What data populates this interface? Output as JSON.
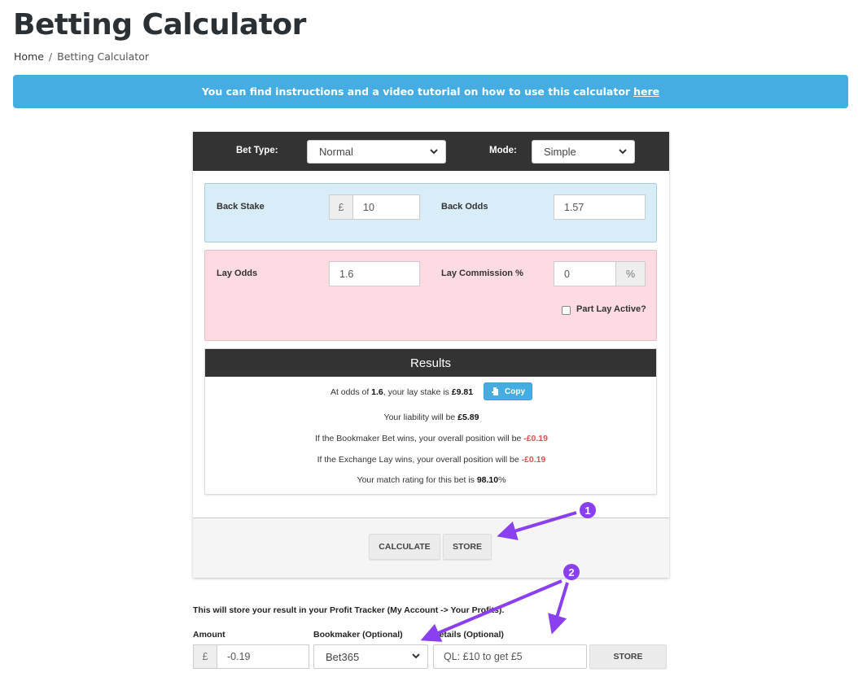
{
  "page": {
    "title": "Betting Calculator",
    "breadcrumb": [
      {
        "label": "Home"
      },
      {
        "separator": "/"
      },
      {
        "label": "Betting Calculator"
      }
    ]
  },
  "banner": {
    "text": "You can find instructions and a video tutorial on how to use this calculator",
    "link_label": "here",
    "color": "#46ade2"
  },
  "calculator": {
    "bet_type_label": "Bet Type:",
    "bet_type_value": "Normal",
    "mode_label": "Mode:",
    "mode_value": "Simple",
    "back": {
      "stake_label": "Back Stake",
      "currency_symbol": "£",
      "stake_value": "10",
      "odds_label": "Back Odds",
      "odds_value": "1.57"
    },
    "lay": {
      "odds_label": "Lay Odds",
      "odds_value": "1.6",
      "commission_label": "Lay Commission %",
      "commission_value": "0",
      "commission_suffix": "%",
      "part_lay_label": "Part Lay Active?",
      "part_lay_checked": false
    },
    "results": {
      "title": "Results",
      "line1_prefix": "At odds of ",
      "line1_odds": "1.6",
      "line1_mid": ", your lay stake is ",
      "line1_stake": "£9.81",
      "copy_label": "Copy",
      "line2_prefix": "Your liability will be ",
      "line2_value": "£5.89",
      "line3_prefix": "If the Bookmaker Bet wins, your overall position will be ",
      "line3_value": "-£0.19",
      "line4_prefix": "If the Exchange Lay wins, your overall position will be ",
      "line4_value": "-£0.19",
      "line5_prefix": "Your match rating for this bet is ",
      "line5_value": "98.10",
      "line5_suffix": "%"
    },
    "buttons": {
      "calculate": "CALCULATE",
      "store": "STORE"
    }
  },
  "store_form": {
    "note": "This will store your result in your Profit Tracker (My Account -> Your Profits).",
    "amount_label": "Amount",
    "amount_currency": "£",
    "amount_value": "-0.19",
    "bookmaker_label": "Bookmaker (Optional)",
    "bookmaker_value": "Bet365",
    "details_label": "Details (Optional)",
    "details_value": "QL: £10 to get £5",
    "store_button": "STORE"
  },
  "annotations": {
    "marker_1": "1",
    "marker_2": "2",
    "color": "#8a3ff0"
  }
}
